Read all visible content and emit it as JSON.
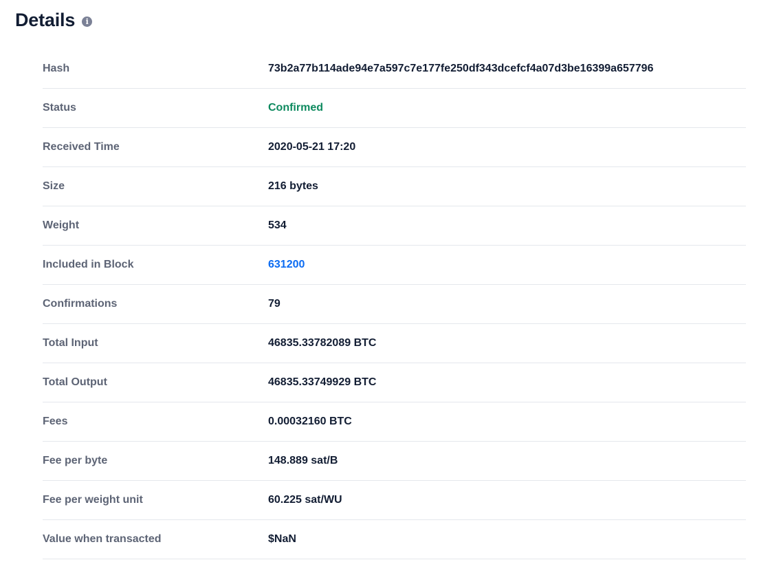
{
  "header": {
    "title": "Details",
    "info_icon": "info-icon"
  },
  "colors": {
    "status_confirmed": "#0e8a5f",
    "link": "#0c6cf2",
    "label": "#5d6475",
    "value": "#121d33"
  },
  "details": {
    "rows": [
      {
        "label": "Hash",
        "value": "73b2a77b114ade94e7a597c7e177fe250df343dcefcf4a07d3be16399a657796"
      },
      {
        "label": "Status",
        "value": "Confirmed"
      },
      {
        "label": "Received Time",
        "value": "2020-05-21 17:20"
      },
      {
        "label": "Size",
        "value": "216 bytes"
      },
      {
        "label": "Weight",
        "value": "534"
      },
      {
        "label": "Included in Block",
        "value": "631200"
      },
      {
        "label": "Confirmations",
        "value": "79"
      },
      {
        "label": "Total Input",
        "value": "46835.33782089 BTC"
      },
      {
        "label": "Total Output",
        "value": "46835.33749929 BTC"
      },
      {
        "label": "Fees",
        "value": "0.00032160 BTC"
      },
      {
        "label": "Fee per byte",
        "value": "148.889 sat/B"
      },
      {
        "label": "Fee per weight unit",
        "value": "60.225 sat/WU"
      },
      {
        "label": "Value when transacted",
        "value": "$NaN"
      }
    ]
  }
}
